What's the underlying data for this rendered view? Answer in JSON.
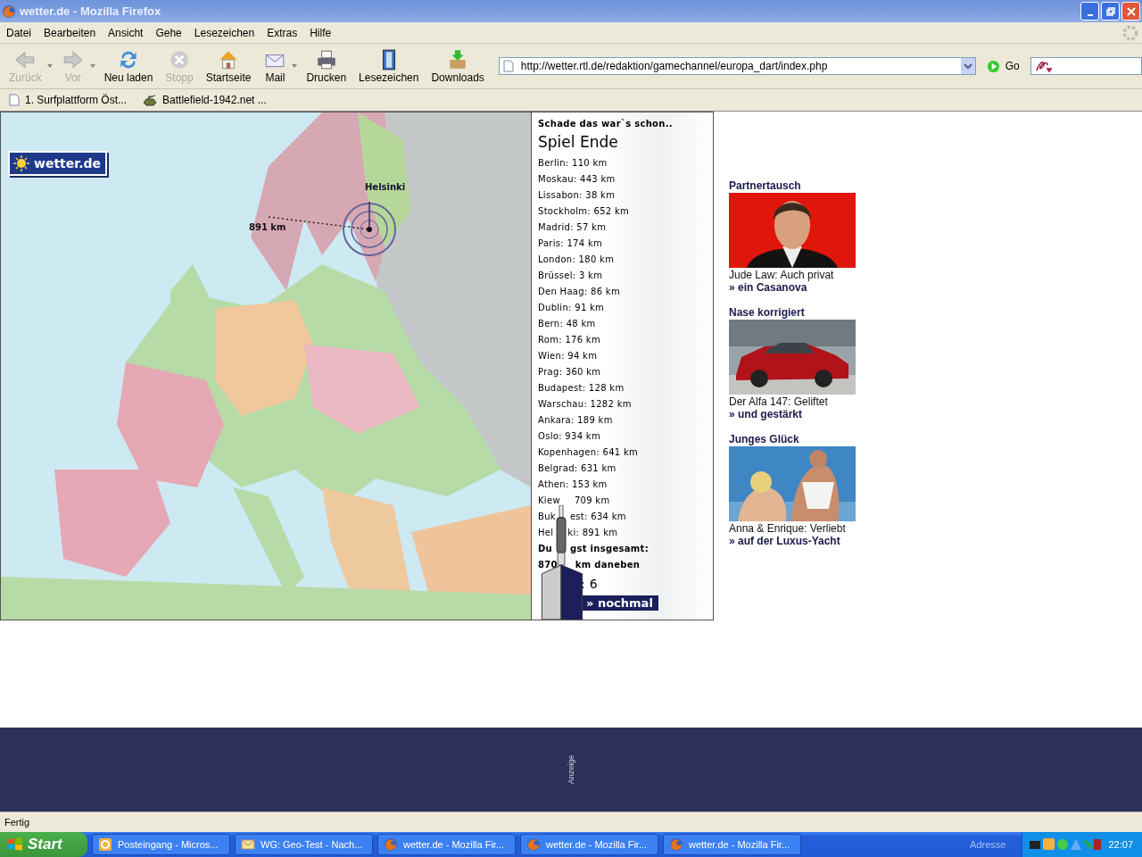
{
  "window": {
    "title": "wetter.de - Mozilla Firefox"
  },
  "menu": [
    "Datei",
    "Bearbeiten",
    "Ansicht",
    "Gehe",
    "Lesezeichen",
    "Extras",
    "Hilfe"
  ],
  "toolbar": [
    {
      "label": "Zurück",
      "kind": "back",
      "disabled": true,
      "dropdown": true
    },
    {
      "label": "Vor",
      "kind": "forward",
      "disabled": true,
      "dropdown": true
    },
    {
      "label": "Neu laden",
      "kind": "reload",
      "disabled": false,
      "dropdown": false
    },
    {
      "label": "Stopp",
      "kind": "stop",
      "disabled": true,
      "dropdown": false
    },
    {
      "label": "Startseite",
      "kind": "home",
      "disabled": false,
      "dropdown": false
    },
    {
      "label": "Mail",
      "kind": "mail",
      "disabled": false,
      "dropdown": true
    },
    {
      "label": "Drucken",
      "kind": "print",
      "disabled": false,
      "dropdown": false
    },
    {
      "label": "Lesezeichen",
      "kind": "bookmarks",
      "disabled": false,
      "dropdown": false
    },
    {
      "label": "Downloads",
      "kind": "downloads",
      "disabled": false,
      "dropdown": false
    }
  ],
  "address": {
    "value": "http://wetter.rtl.de/redaktion/gamechannel/europa_dart/index.php",
    "go": "Go"
  },
  "bookmarks": [
    {
      "label": "1. Surfplattform Öst...",
      "kind": "page"
    },
    {
      "label": "Battlefield-1942.net ...",
      "kind": "tank"
    }
  ],
  "map": {
    "logo": "wetter.de",
    "target": "Helsinki",
    "distance": "891 km"
  },
  "game": {
    "intro": "Schade das war`s schon..",
    "heading": "Spiel Ende",
    "results": [
      {
        "text": "Berlin: 110 km"
      },
      {
        "text": "Moskau: 443 km"
      },
      {
        "text": "Lissabon: 38 km"
      },
      {
        "text": "Stockholm: 652 km"
      },
      {
        "text": "Madrid: 57 km"
      },
      {
        "text": "Paris: 174 km"
      },
      {
        "text": "London: 180 km"
      },
      {
        "text": "Brüssel: 3 km"
      },
      {
        "text": "Den Haag: 86 km"
      },
      {
        "text": "Dublin: 91 km"
      },
      {
        "text": "Bern: 48 km"
      },
      {
        "text": "Rom: 176 km"
      },
      {
        "text": "Wien: 94 km"
      },
      {
        "text": "Prag: 360 km"
      },
      {
        "text": "Budapest: 128 km"
      },
      {
        "text": "Warschau: 1282 km"
      },
      {
        "text": "Ankara: 189 km"
      },
      {
        "text": "Oslo: 934 km"
      },
      {
        "text": "Kopenhagen: 641 km"
      },
      {
        "text": "Belgrad: 631 km"
      },
      {
        "text": "Athen: 153 km"
      },
      {
        "text": "Kiew",
        "text_after": "709 km"
      },
      {
        "text": "Buk",
        "text_after": "est: 634 km"
      },
      {
        "text": "Hel",
        "text_after": "ki: 891 km"
      }
    ],
    "total": [
      {
        "text": "Du",
        "text_after": "gst insgesamt:"
      },
      {
        "text": "870",
        "text_after": "km daneben"
      }
    ],
    "score": ": 6",
    "button": "» nochmal"
  },
  "teasers": [
    {
      "heading": "Partnertausch",
      "caption": "Jude Law: Auch privat",
      "link": "» ein Casanova"
    },
    {
      "heading": "Nase korrigiert",
      "caption": "Der Alfa 147: Geliftet",
      "link": "» und gestärkt"
    },
    {
      "heading": "Junges Glück",
      "caption": "Anna & Enrique: Verliebt",
      "link": "» auf der Luxus-Yacht"
    }
  ],
  "ad": {
    "label": "Anzeige"
  },
  "status": "Fertig",
  "taskbar": {
    "start": "Start",
    "tasks": [
      {
        "label": "Posteingang - Micros...",
        "kind": "outlook"
      },
      {
        "label": "WG: Geo-Test - Nach...",
        "kind": "mail"
      },
      {
        "label": "wetter.de - Mozilla Fir...",
        "kind": "firefox"
      },
      {
        "label": "wetter.de - Mozilla Fir...",
        "kind": "firefox"
      },
      {
        "label": "wetter.de - Mozilla Fir...",
        "kind": "firefox"
      }
    ],
    "address": "Adresse",
    "clock": "22:07"
  }
}
